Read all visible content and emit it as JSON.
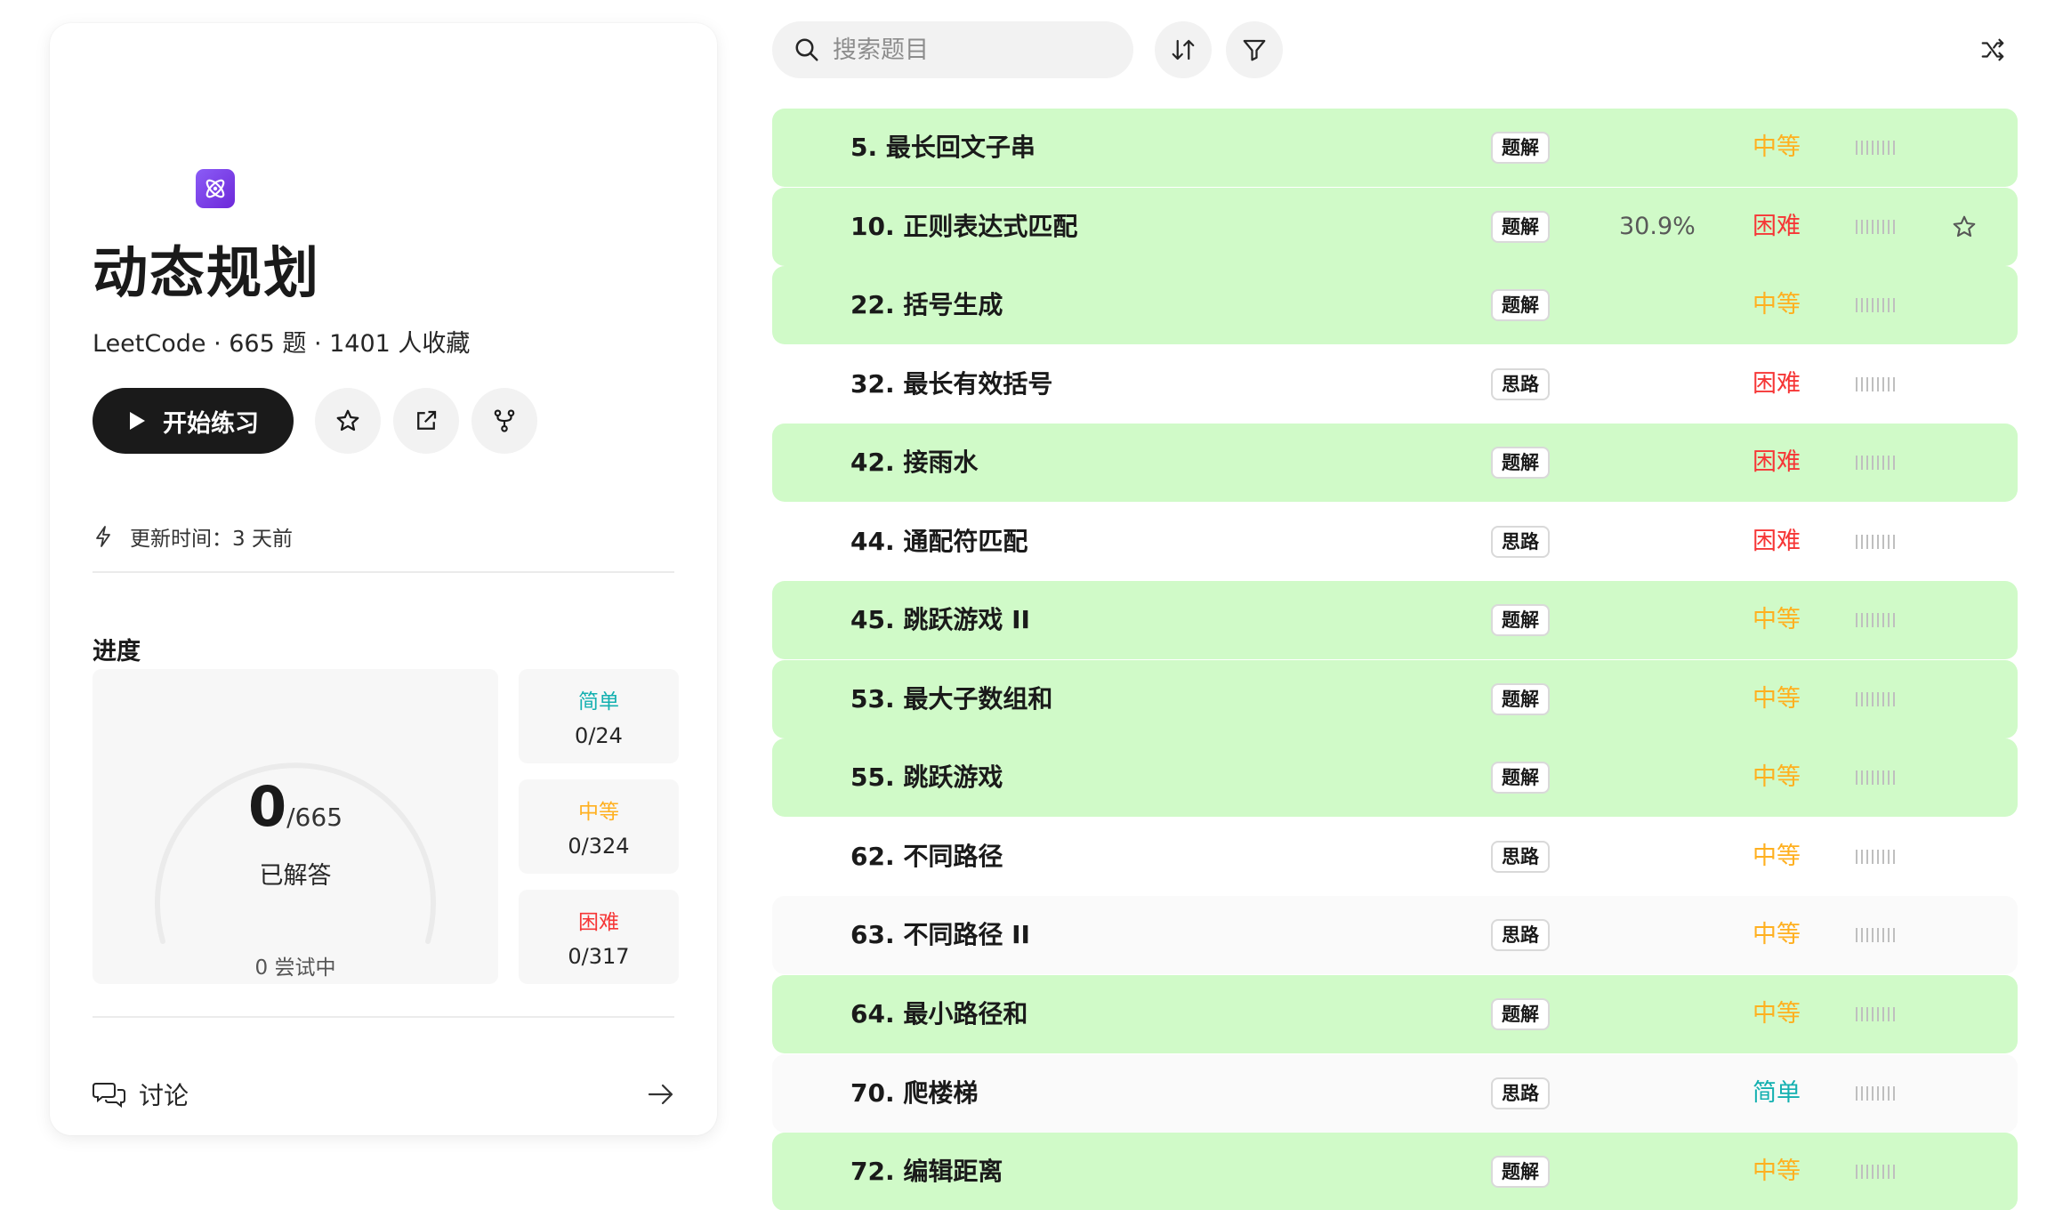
{
  "sidebar": {
    "title": "动态规划",
    "meta": "LeetCode · 665 题 · 1401 人收藏",
    "start_label": "开始练习",
    "update_text": "更新时间：3 天前",
    "progress_label": "进度",
    "solved_count": "0",
    "total": "/665",
    "solved_label": "已解答",
    "solved_fraction": 0,
    "trying_text": "0 尝试中",
    "difficulty": [
      {
        "name": "简单",
        "value": "0/24",
        "color": "#14b0b0"
      },
      {
        "name": "中等",
        "value": "0/324",
        "color": "#ffb020"
      },
      {
        "name": "困难",
        "value": "0/317",
        "color": "#f63636"
      }
    ],
    "discuss_label": "讨论"
  },
  "toolbar": {
    "search_placeholder": "搜索题目"
  },
  "colors": {
    "easy": "#14b0b0",
    "medium": "#ffb020",
    "hard": "#f63636",
    "solved_row": "#d0fac8",
    "icon_purple": "#7c3aed"
  },
  "problems": [
    {
      "title": "5. 最长回文子串",
      "tag": "题解",
      "rate": "",
      "difficulty": "中等",
      "level": "medium",
      "solved": true,
      "starred": false
    },
    {
      "title": "10. 正则表达式匹配",
      "tag": "题解",
      "rate": "30.9%",
      "difficulty": "困难",
      "level": "hard",
      "solved": true,
      "starred": false,
      "hover": true
    },
    {
      "title": "22. 括号生成",
      "tag": "题解",
      "rate": "",
      "difficulty": "中等",
      "level": "medium",
      "solved": true,
      "starred": false
    },
    {
      "title": "32. 最长有效括号",
      "tag": "思路",
      "rate": "",
      "difficulty": "困难",
      "level": "hard",
      "solved": false,
      "starred": false
    },
    {
      "title": "42. 接雨水",
      "tag": "题解",
      "rate": "",
      "difficulty": "困难",
      "level": "hard",
      "solved": true,
      "starred": false
    },
    {
      "title": "44. 通配符匹配",
      "tag": "思路",
      "rate": "",
      "difficulty": "困难",
      "level": "hard",
      "solved": false,
      "starred": false
    },
    {
      "title": "45. 跳跃游戏 II",
      "tag": "题解",
      "rate": "",
      "difficulty": "中等",
      "level": "medium",
      "solved": true,
      "starred": false
    },
    {
      "title": "53. 最大子数组和",
      "tag": "题解",
      "rate": "",
      "difficulty": "中等",
      "level": "medium",
      "solved": true,
      "starred": false
    },
    {
      "title": "55. 跳跃游戏",
      "tag": "题解",
      "rate": "",
      "difficulty": "中等",
      "level": "medium",
      "solved": true,
      "starred": false
    },
    {
      "title": "62. 不同路径",
      "tag": "思路",
      "rate": "",
      "difficulty": "中等",
      "level": "medium",
      "solved": false,
      "starred": false
    },
    {
      "title": "63. 不同路径 II",
      "tag": "思路",
      "rate": "",
      "difficulty": "中等",
      "level": "medium",
      "solved": false,
      "starred": false
    },
    {
      "title": "64. 最小路径和",
      "tag": "题解",
      "rate": "",
      "difficulty": "中等",
      "level": "medium",
      "solved": true,
      "starred": false
    },
    {
      "title": "70. 爬楼梯",
      "tag": "思路",
      "rate": "",
      "difficulty": "简单",
      "level": "easy",
      "solved": false,
      "starred": false
    },
    {
      "title": "72. 编辑距离",
      "tag": "题解",
      "rate": "",
      "difficulty": "中等",
      "level": "medium",
      "solved": true,
      "starred": false
    }
  ]
}
